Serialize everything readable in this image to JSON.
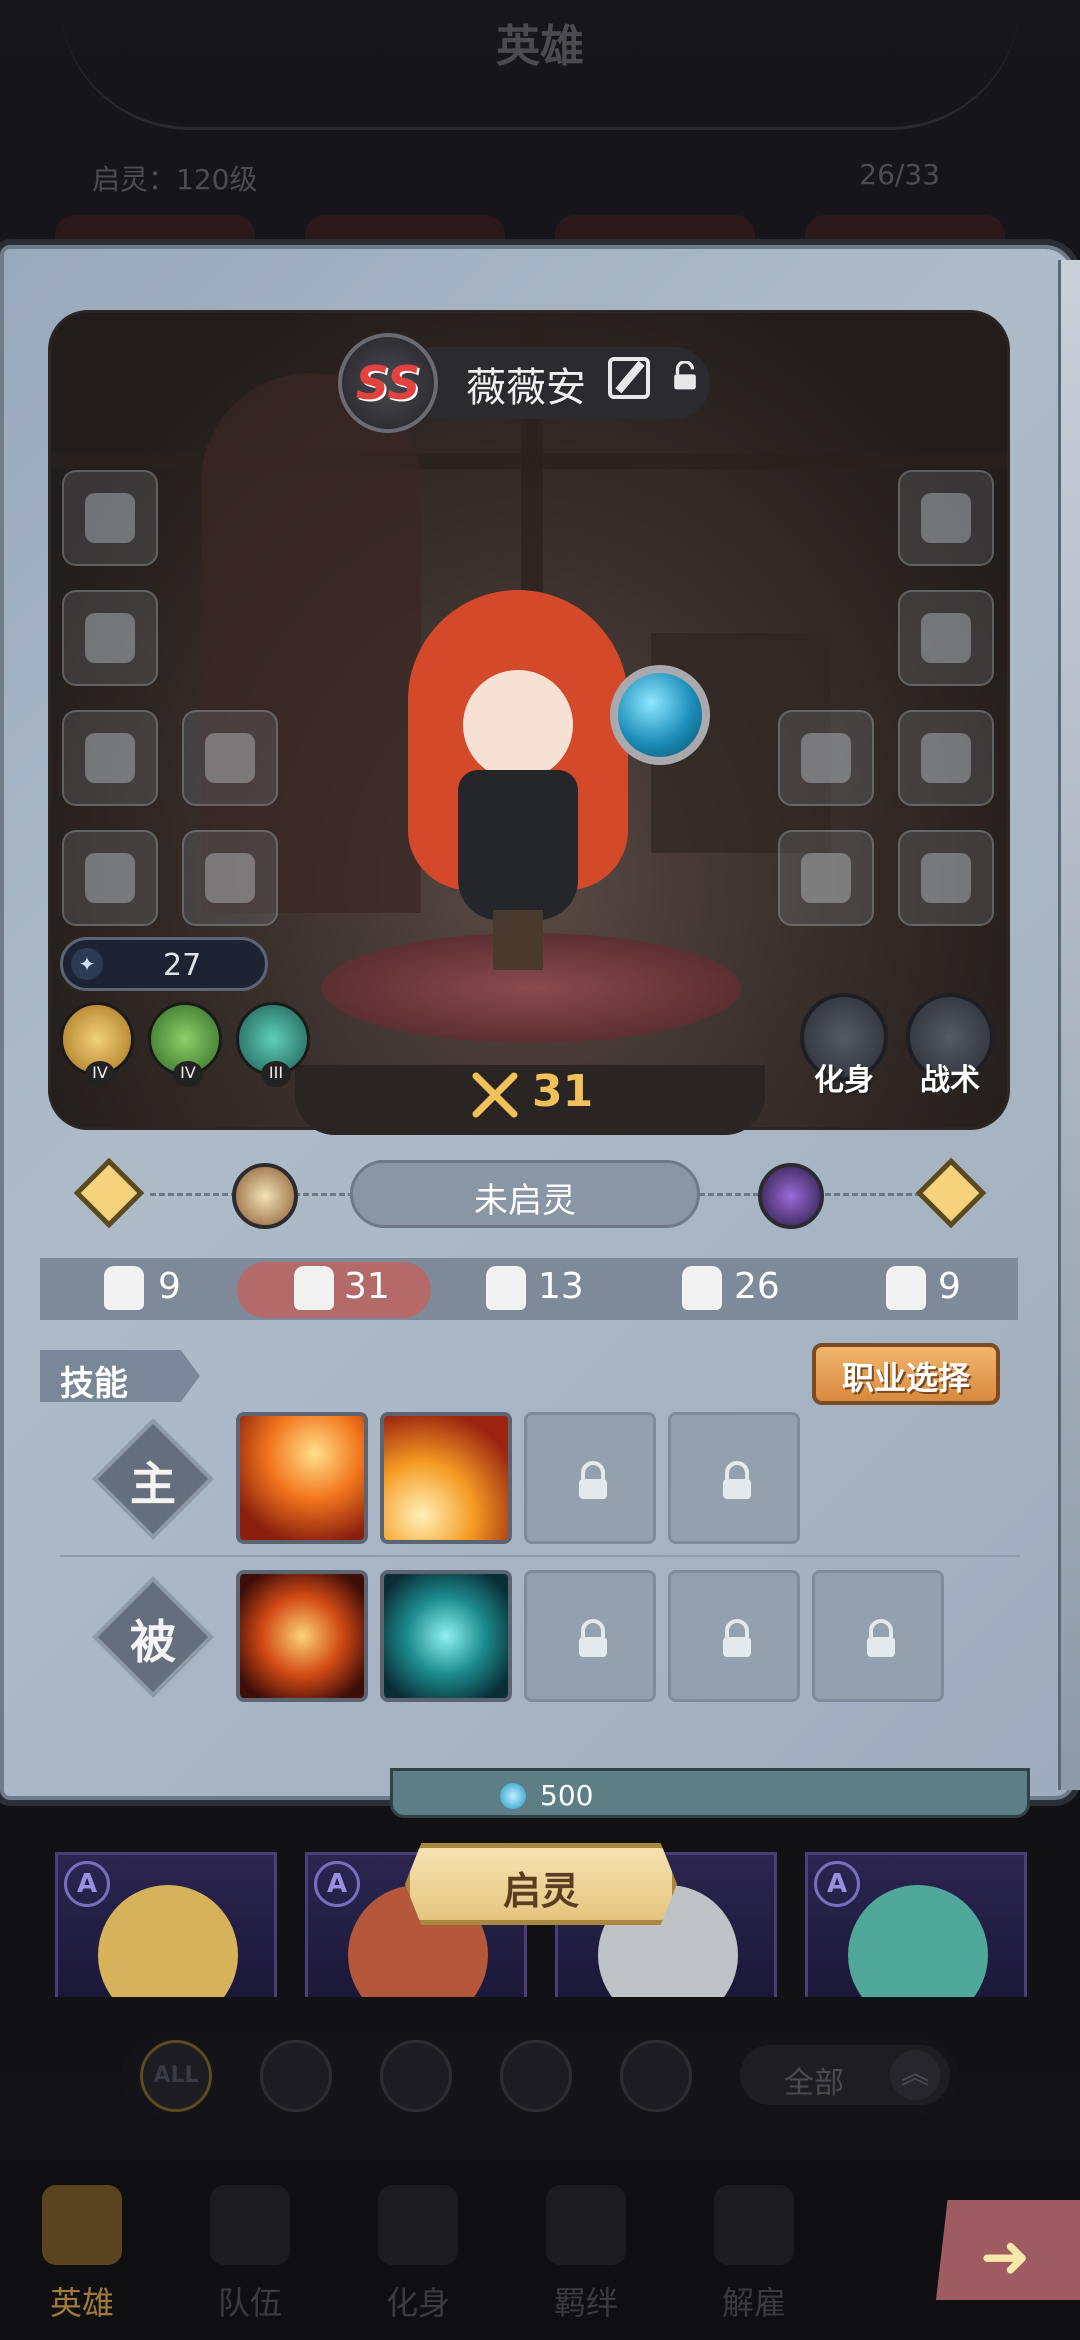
{
  "header": {
    "title": "英雄",
    "awaken_level": "启灵：120级",
    "hero_count": "26/33"
  },
  "hero": {
    "rank": "SS",
    "name": "薇薇安",
    "level": "27",
    "power": "31",
    "factions": [
      {
        "icon": "sun-burst-icon",
        "tier": "IV",
        "color": "#d8a23a"
      },
      {
        "icon": "leaf-icon",
        "tier": "IV",
        "color": "#4f9a3a"
      },
      {
        "icon": "eye-icon",
        "tier": "III",
        "color": "#2c8a78"
      }
    ],
    "actions": {
      "avatar_label": "化身",
      "tactics_label": "战术"
    }
  },
  "awaken": {
    "status": "未启灵"
  },
  "stats": [
    {
      "icon": "fist-icon",
      "value": "9"
    },
    {
      "icon": "brain-icon",
      "value": "31"
    },
    {
      "icon": "boot-icon",
      "value": "13"
    },
    {
      "icon": "spark-icon",
      "value": "26"
    },
    {
      "icon": "arm-icon",
      "value": "9"
    }
  ],
  "skills": {
    "title": "技能",
    "job_button": "职业选择",
    "active_label": "主",
    "passive_label": "被",
    "active": [
      {
        "icon": "meteor-icon",
        "locked": false
      },
      {
        "icon": "burst-icon",
        "locked": false
      },
      {
        "icon": "lock-icon",
        "locked": true
      },
      {
        "icon": "lock-icon",
        "locked": true
      }
    ],
    "passive": [
      {
        "icon": "aura-icon",
        "locked": false
      },
      {
        "icon": "dash-icon",
        "locked": false
      },
      {
        "icon": "lock-icon",
        "locked": true
      },
      {
        "icon": "lock-icon",
        "locked": true
      },
      {
        "icon": "lock-icon",
        "locked": true
      }
    ]
  },
  "cost": {
    "value": "500"
  },
  "awaken_button": "启灵",
  "roster": [
    {
      "rank": "A",
      "hair": "#d6b35a"
    },
    {
      "rank": "A",
      "hair": "#b5573a"
    },
    {
      "rank": "A",
      "hair": "#bfc3c8"
    },
    {
      "rank": "A",
      "hair": "#4fa89a"
    }
  ],
  "filters": {
    "all_label": "ALL",
    "dropdown_label": "全部"
  },
  "nav": [
    {
      "label": "英雄",
      "active": true
    },
    {
      "label": "队伍",
      "active": false
    },
    {
      "label": "化身",
      "active": false
    },
    {
      "label": "羁绊",
      "active": false
    },
    {
      "label": "解雇",
      "active": false
    }
  ],
  "colors": {
    "accent_gold": "#f2c15a",
    "job_button": "#e19a4a",
    "stat_highlight": "#b56a6a"
  }
}
